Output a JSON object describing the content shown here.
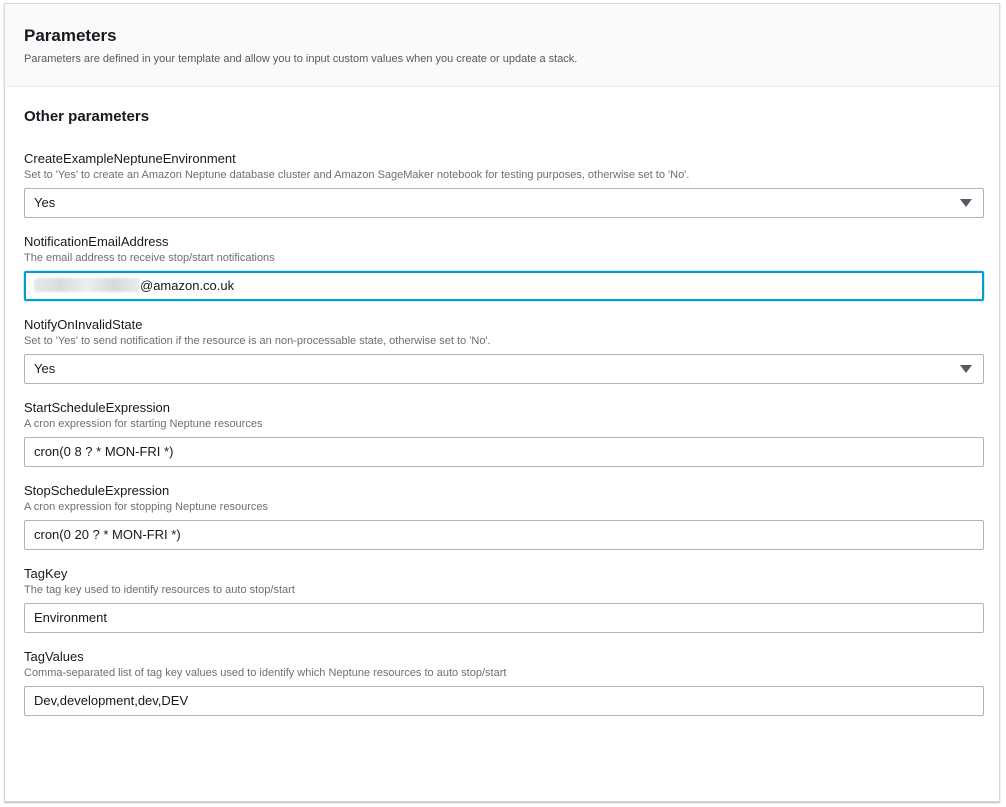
{
  "header": {
    "title": "Parameters",
    "description": "Parameters are defined in your template and allow you to input custom values when you create or update a stack."
  },
  "section": {
    "title": "Other parameters"
  },
  "fields": [
    {
      "label": "CreateExampleNeptuneEnvironment",
      "description": "Set to 'Yes' to create an Amazon Neptune database cluster and Amazon SageMaker notebook for testing purposes, otherwise set to 'No'.",
      "type": "select",
      "value": "Yes"
    },
    {
      "label": "NotificationEmailAddress",
      "description": "The email address to receive stop/start notifications",
      "type": "input",
      "value_suffix": "@amazon.co.uk",
      "focused": true
    },
    {
      "label": "NotifyOnInvalidState",
      "description": "Set to 'Yes' to send notification if the resource is an non-processable state, otherwise set to 'No'.",
      "type": "select",
      "value": "Yes"
    },
    {
      "label": "StartScheduleExpression",
      "description": "A cron expression for starting Neptune resources",
      "type": "input",
      "value": "cron(0 8 ? * MON-FRI *)"
    },
    {
      "label": "StopScheduleExpression",
      "description": "A cron expression for stopping Neptune resources",
      "type": "input",
      "value": "cron(0 20 ? * MON-FRI *)"
    },
    {
      "label": "TagKey",
      "description": "The tag key used to identify resources to auto stop/start",
      "type": "input",
      "value": "Environment"
    },
    {
      "label": "TagValues",
      "description": "Comma-separated list of tag key values used to identify which Neptune resources to auto stop/start",
      "type": "input",
      "value": "Dev,development,dev,DEV"
    }
  ],
  "icons": {
    "select_caret": "caret-down-icon"
  },
  "colors": {
    "focus_border": "#00a1c9",
    "input_border": "#aab7b8",
    "header_bg": "#fafafa"
  }
}
